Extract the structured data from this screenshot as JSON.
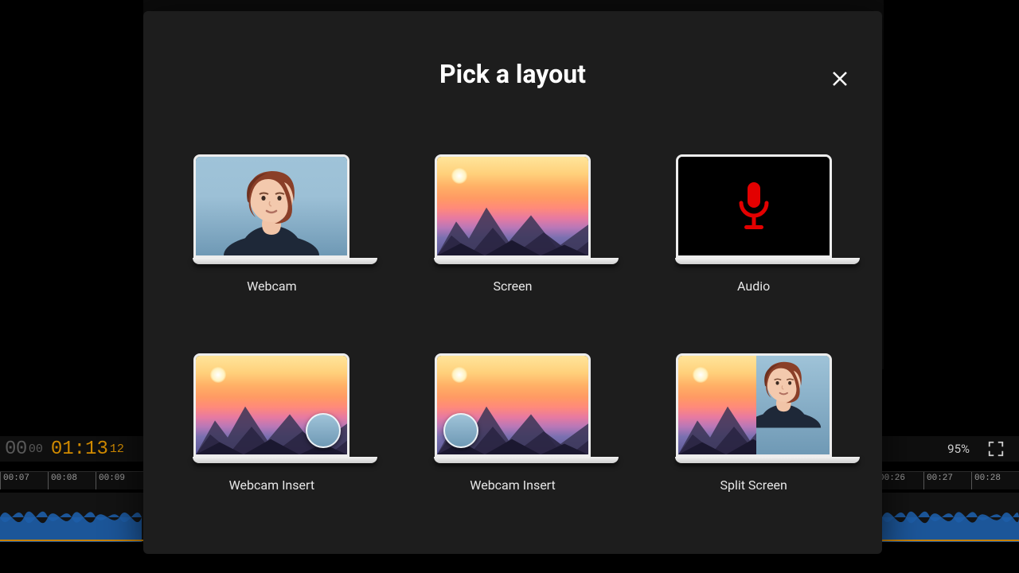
{
  "modal": {
    "title": "Pick a layout",
    "options": [
      {
        "label": "Webcam"
      },
      {
        "label": "Screen"
      },
      {
        "label": "Audio"
      },
      {
        "label": "Webcam Insert"
      },
      {
        "label": "Webcam Insert"
      },
      {
        "label": "Split Screen"
      }
    ]
  },
  "timeline": {
    "current_time": "00",
    "current_frames": "00",
    "total_time": "01:13",
    "total_frames": "12",
    "zoom": "95%",
    "ticks": [
      "00:07",
      "00:08",
      "00:09",
      "00:26",
      "00:27",
      "00:28"
    ]
  }
}
